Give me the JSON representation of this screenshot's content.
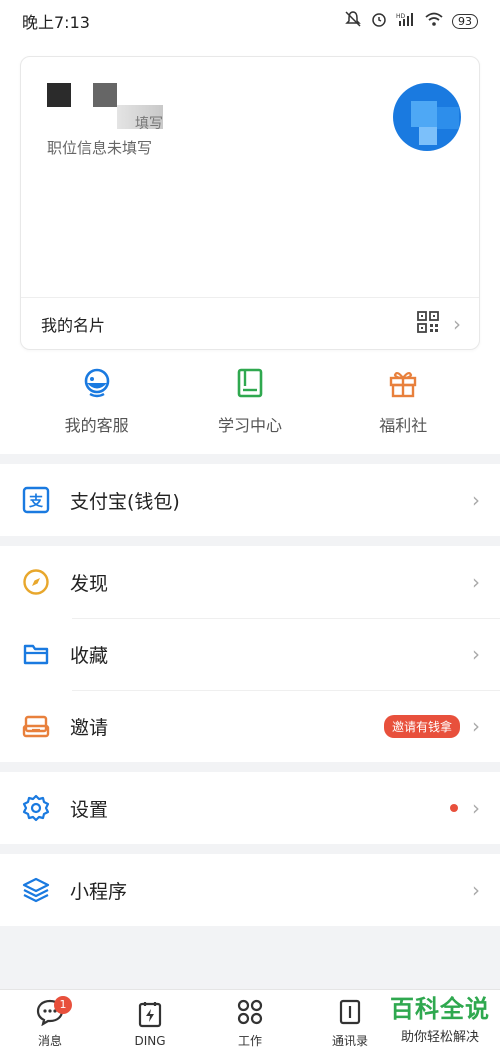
{
  "status": {
    "time": "晚上7:13",
    "battery": "93",
    "signal": "HD"
  },
  "card": {
    "company_suffix": "填写",
    "job_info": "职位信息未填写",
    "footer_label": "我的名片"
  },
  "quick": [
    {
      "label": "我的客服",
      "icon": "headset-icon"
    },
    {
      "label": "学习中心",
      "icon": "book-icon"
    },
    {
      "label": "福利社",
      "icon": "gift-icon"
    }
  ],
  "menu": {
    "alipay": {
      "label": "支付宝(钱包)"
    },
    "discover": {
      "label": "发现"
    },
    "favorites": {
      "label": "收藏"
    },
    "invite": {
      "label": "邀请",
      "badge": "邀请有钱拿"
    },
    "settings": {
      "label": "设置"
    },
    "miniapp": {
      "label": "小程序"
    }
  },
  "tabs": [
    {
      "label": "消息",
      "badge": "1"
    },
    {
      "label": "DING"
    },
    {
      "label": "工作"
    },
    {
      "label": "通讯录"
    }
  ],
  "watermark": {
    "title": "百科全说",
    "subtitle": "助你轻松解决"
  },
  "colors": {
    "accent": "#1a7ae0",
    "badge": "#e8503c",
    "green": "#2fa84f",
    "orange": "#e8803c",
    "yellow": "#e8a72c"
  }
}
